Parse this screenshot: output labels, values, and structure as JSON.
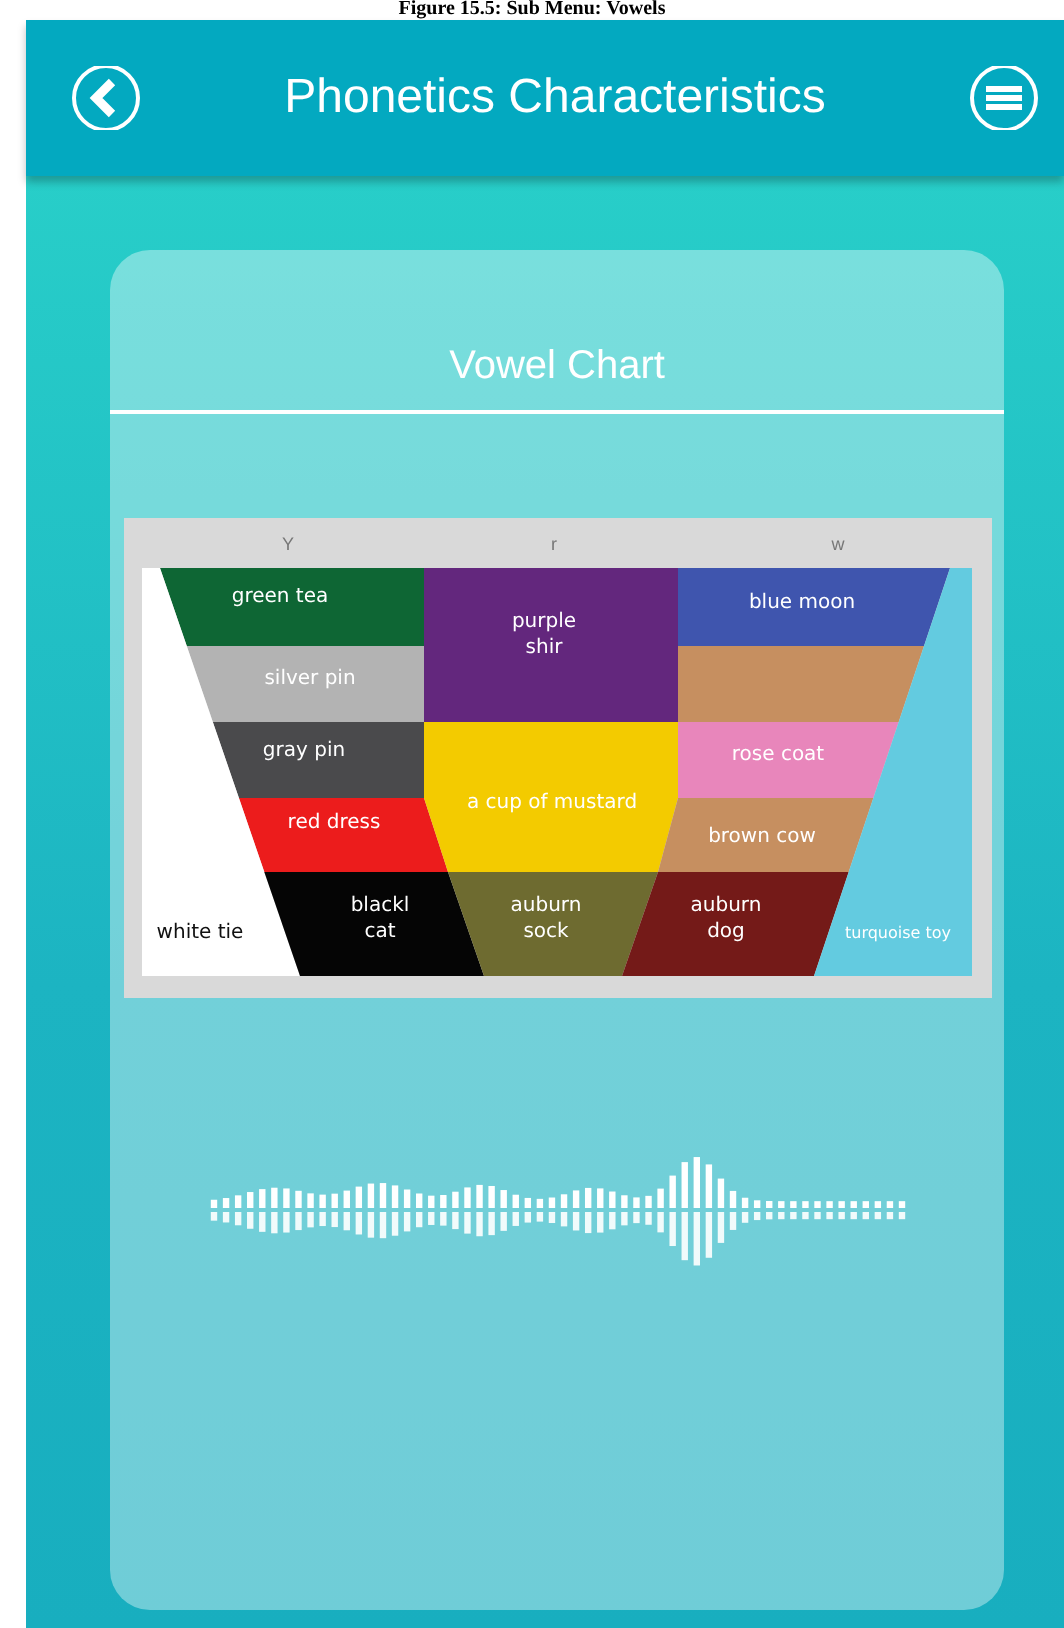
{
  "caption": "Figure 15.5: Sub Menu: Vowels",
  "header": {
    "title": "Phonetics Characteristics"
  },
  "card": {
    "title": "Vowel Chart",
    "column_labels": [
      "Y",
      "r",
      "w"
    ],
    "cells": [
      {
        "label": [
          "green tea"
        ],
        "color": "#0e6634"
      },
      {
        "label": [
          "purple",
          "shir"
        ],
        "color": "#63277d"
      },
      {
        "label": [
          "blue moon"
        ],
        "color": "#3f55ae"
      },
      {
        "label": [
          "silver pin"
        ],
        "color": "#b3b3b3"
      },
      {
        "color": "#c68f60"
      },
      {
        "label": [
          "gray pin"
        ],
        "color": "#4a4a4c"
      },
      {
        "label": [
          "rose coat"
        ],
        "color": "#e886bb"
      },
      {
        "label": [
          "red dress"
        ],
        "color": "#ec1c1c"
      },
      {
        "label": [
          "a cup of mustard"
        ],
        "color": "#f3cb00"
      },
      {
        "label": [
          "brown cow"
        ],
        "color": "#c68f60"
      },
      {
        "label": [
          "white tie"
        ],
        "color": "#ffffff"
      },
      {
        "label": [
          "blackl",
          "cat"
        ],
        "color": "#050505"
      },
      {
        "label": [
          "auburn",
          "sock"
        ],
        "color": "#6e6b30"
      },
      {
        "label": [
          "auburn",
          "dog"
        ],
        "color": "#741a18"
      },
      {
        "label": [
          "turquoise toy"
        ],
        "color": "#63cbe0"
      }
    ]
  }
}
